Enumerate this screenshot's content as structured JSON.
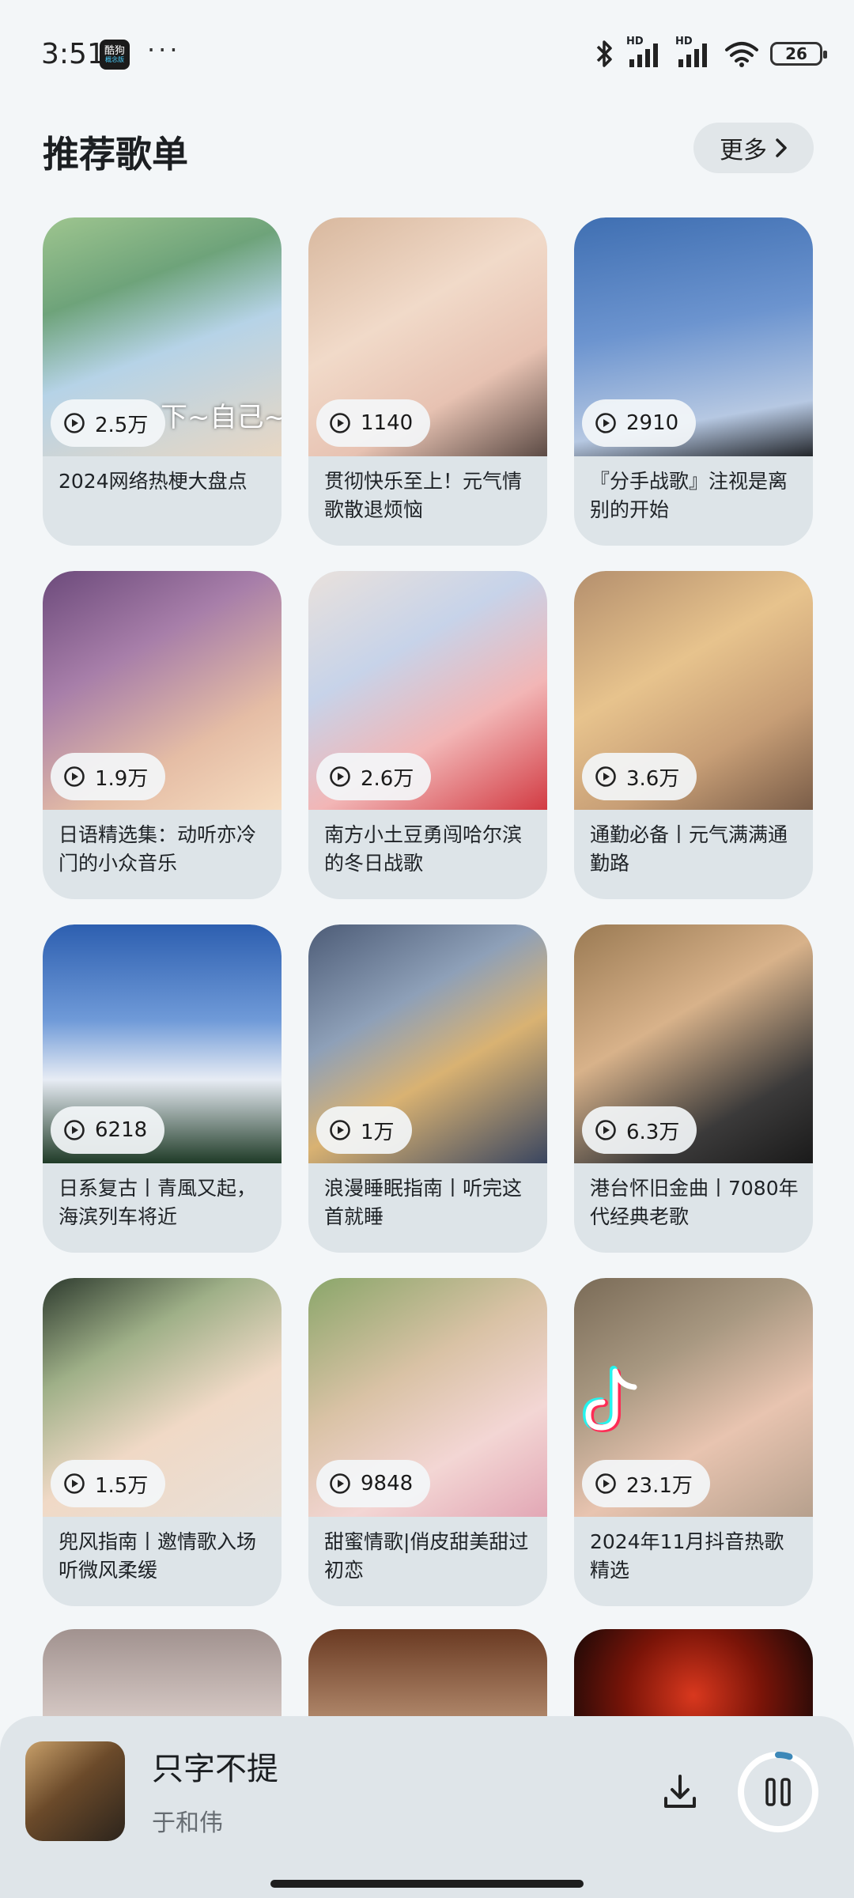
{
  "status_bar": {
    "time": "3:51",
    "app_badge_top": "酷狗",
    "app_badge_bottom": "概念版",
    "dots": "···",
    "signal_1_label": "HD",
    "signal_2_label": "HD",
    "battery": "26"
  },
  "header": {
    "title": "推荐歌单",
    "more_label": "更多"
  },
  "playlists": [
    {
      "plays": "2.5万",
      "title": "2024网络热梗大盘点"
    },
    {
      "plays": "1140",
      "title": "贯彻快乐至上！元气情歌散退烦恼"
    },
    {
      "plays": "2910",
      "title": "『分手战歌』注视是离别的开始"
    },
    {
      "plays": "1.9万",
      "title": "日语精选集：动听亦冷门的小众音乐"
    },
    {
      "plays": "2.6万",
      "title": "南方小土豆勇闯哈尔滨的冬日战歌"
    },
    {
      "plays": "3.6万",
      "title": "通勤必备丨元气满满通勤路"
    },
    {
      "plays": "6218",
      "title": "日系复古丨青風又起，海滨列车将近"
    },
    {
      "plays": "1万",
      "title": "浪漫睡眠指南丨听完这首就睡"
    },
    {
      "plays": "6.3万",
      "title": "港台怀旧金曲丨7080年代经典老歌"
    },
    {
      "plays": "1.5万",
      "title": "兜风指南丨邀情歌入场听微风柔缓"
    },
    {
      "plays": "9848",
      "title": "甜蜜情歌|俏皮甜美甜过初恋"
    },
    {
      "plays": "23.1万",
      "title": "2024年11月抖音热歌精选"
    }
  ],
  "cover_text_1": "下~自己~",
  "mini_player": {
    "song_title": "只字不提",
    "artist": "于和伟",
    "progress": 0.05
  },
  "colors": {
    "background": "#f3f6f8",
    "card": "#dde4e8",
    "player": "#dfe5e9"
  }
}
